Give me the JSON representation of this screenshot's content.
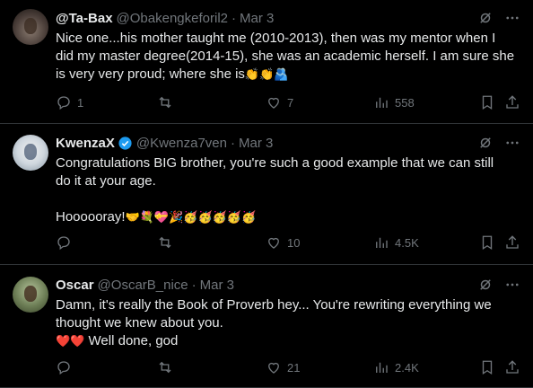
{
  "tweets": [
    {
      "name": "@Ta-Bax",
      "handle": "@Obakengkeforil2",
      "time": "Mar 3",
      "verified": false,
      "text_lines": [
        "Nice one...his mother taught me (2010-2013), then was my mentor when I",
        "did my master degree(2014-15), she was an academic herself. I am sure she",
        "is very very proud; where she is"
      ],
      "emojis": "👏👏🫂",
      "replies": "1",
      "reposts": "",
      "likes": "7",
      "views": "558"
    },
    {
      "name": "KwenzaX",
      "handle": "@Kwenza7ven",
      "time": "Mar 3",
      "verified": true,
      "text_lines": [
        "Congratulations BIG brother, you're such a good example that we can still",
        "do it at your age."
      ],
      "hooray_text": "Hoooooray!",
      "emojis": "🤝💐💝🎉🥳🥳🥳🥳🥳",
      "replies": "",
      "reposts": "",
      "likes": "10",
      "views": "4.5K"
    },
    {
      "name": "Oscar",
      "handle": "@OscarB_nice",
      "time": "Mar 3",
      "verified": false,
      "text_lines": [
        "Damn, it's really the Book of Proverb hey... You're rewriting everything we",
        "thought we knew about you."
      ],
      "hearts": "❤️❤️",
      "closing_text": "Well done, god",
      "replies": "",
      "reposts": "",
      "likes": "21",
      "views": "2.4K"
    }
  ],
  "icons": {
    "reply": "reply-icon",
    "repost": "repost-icon",
    "like": "like-icon",
    "views": "views-icon",
    "bookmark": "bookmark-icon",
    "share": "share-icon",
    "grok": "grok-icon",
    "more": "more-icon",
    "verified": "verified-badge-icon"
  },
  "colors": {
    "background": "#000000",
    "text": "#e7e9ea",
    "secondary": "#71767b",
    "verified": "#1d9bf0",
    "divider": "#2f3336"
  }
}
